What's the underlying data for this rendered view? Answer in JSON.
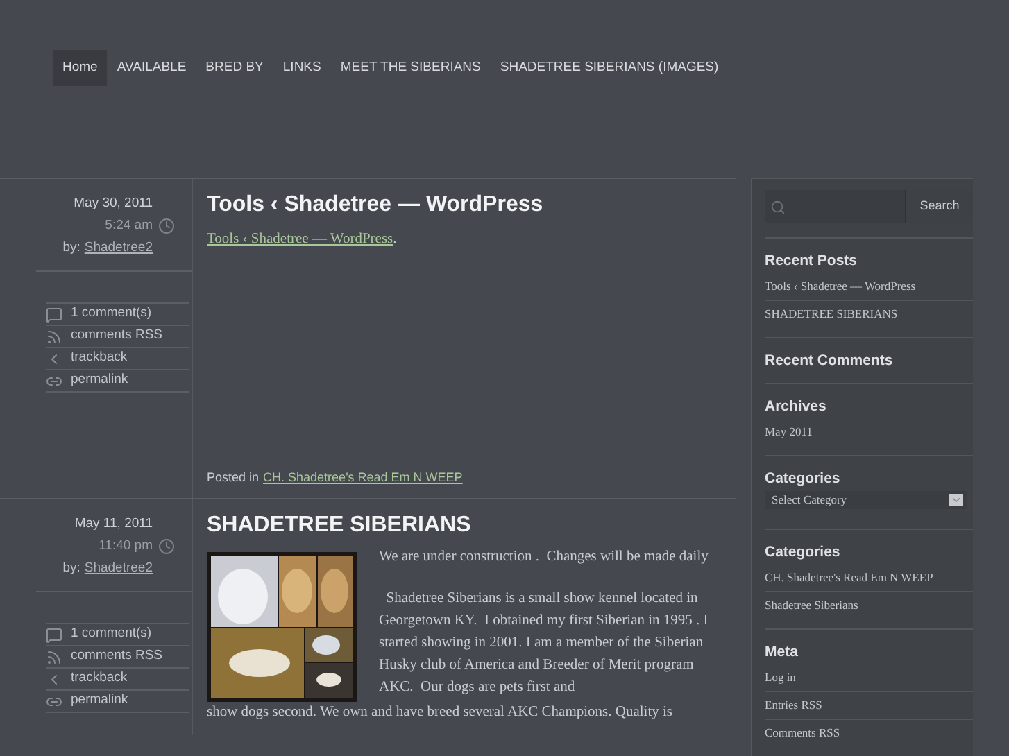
{
  "nav": [
    {
      "label": "Home",
      "selected": true
    },
    {
      "label": "AVAILABLE",
      "selected": false
    },
    {
      "label": "BRED BY",
      "selected": false
    },
    {
      "label": "LINKS",
      "selected": false
    },
    {
      "label": "MEET THE SIBERIANS",
      "selected": false
    },
    {
      "label": "SHADETREE SIBERIANS (IMAGES)",
      "selected": false
    }
  ],
  "posts": [
    {
      "date": "May 30, 2011",
      "time": "5:24 am",
      "author_label": "by:",
      "author": "Shadetree2",
      "actions": [
        {
          "kind": "comments",
          "label": "1 comment(s)"
        },
        {
          "kind": "rss",
          "label": "comments RSS"
        },
        {
          "kind": "trackback",
          "label": "trackback"
        },
        {
          "kind": "permalink",
          "label": "permalink"
        }
      ],
      "title": "Tools ‹ Shadetree — WordPress",
      "body": [
        {
          "kind": "link",
          "link": "Tools ‹ Shadetree — WordPress",
          "after": "."
        }
      ],
      "posted_in_label": "Posted in",
      "category": "CH. Shadetree's Read Em N WEEP"
    },
    {
      "date": "May 11, 2011",
      "time": "11:40 pm",
      "author_label": "by:",
      "author": "Shadetree2",
      "actions": [
        {
          "kind": "comments",
          "label": "1 comment(s)"
        },
        {
          "kind": "rss",
          "label": "comments RSS"
        },
        {
          "kind": "trackback",
          "label": "trackback"
        },
        {
          "kind": "permalink",
          "label": "permalink"
        }
      ],
      "title": "SHADETREE SIBERIANS",
      "body": [
        {
          "kind": "picture"
        },
        {
          "kind": "text",
          "text": "We are under construction .  Changes will be made daily"
        },
        {
          "kind": "wrap_text",
          "beside": "  Shadetree Siberians is a small show kennel located in Georgetown KY.  I obtained my first Siberian in 1995 . I started showing in 2001. I am a member of the Siberian Husky club of America and Breeder of Merit program AKC.  Our dogs are pets first and",
          "below": "show dogs second. We own and have breed several AKC Champions. Quality is"
        }
      ]
    }
  ],
  "sidebar": [
    {
      "kind": "search",
      "button": "Search"
    },
    {
      "kind": "list",
      "title": "Recent Posts",
      "items": [
        "Tools ‹ Shadetree — WordPress",
        "SHADETREE SIBERIANS"
      ]
    },
    {
      "kind": "list",
      "title": "Recent Comments"
    },
    {
      "kind": "list",
      "title": "Archives",
      "items": [
        "May 2011"
      ]
    },
    {
      "kind": "select",
      "title": "Categories",
      "value": "Select Category"
    },
    {
      "kind": "list",
      "title": "Categories",
      "items": [
        "CH. Shadetree's Read Em N WEEP",
        "Shadetree Siberians"
      ]
    },
    {
      "kind": "list",
      "title": "Meta",
      "items": [
        "Log in",
        "Entries RSS",
        "Comments RSS"
      ]
    }
  ]
}
